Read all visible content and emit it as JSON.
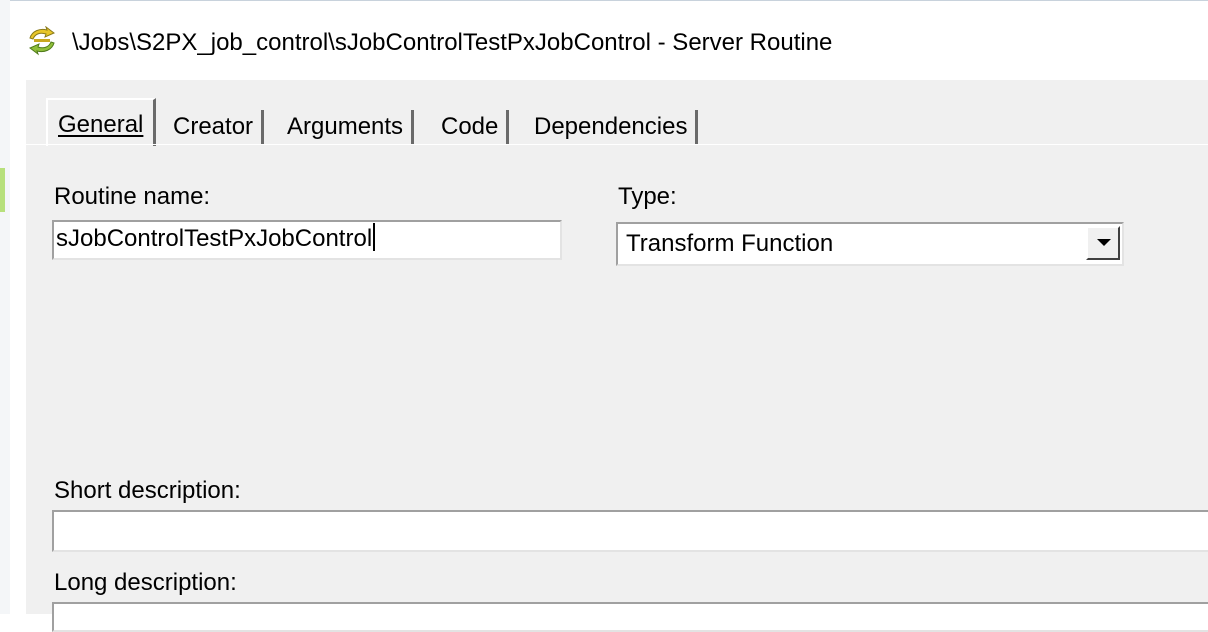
{
  "window": {
    "title": "\\Jobs\\S2PX_job_control\\sJobControlTestPxJobControl - Server Routine",
    "icon": "server-routine-icon"
  },
  "tabs": [
    {
      "label": "General",
      "active": true
    },
    {
      "label": "Creator",
      "active": false
    },
    {
      "label": "Arguments",
      "active": false
    },
    {
      "label": "Code",
      "active": false
    },
    {
      "label": "Dependencies",
      "active": false
    }
  ],
  "form": {
    "routine_name_label": "Routine name:",
    "routine_name_value": "sJobControlTestPxJobControl",
    "type_label": "Type:",
    "type_value": "Transform Function",
    "short_description_label": "Short description:",
    "short_description_value": "",
    "long_description_label": "Long description:",
    "long_description_value": ""
  },
  "colors": {
    "dialog_background": "#f0f0f0",
    "field_background": "#ffffff",
    "icon_yellow": "#e8c62a",
    "icon_green": "#8fbf3a"
  }
}
